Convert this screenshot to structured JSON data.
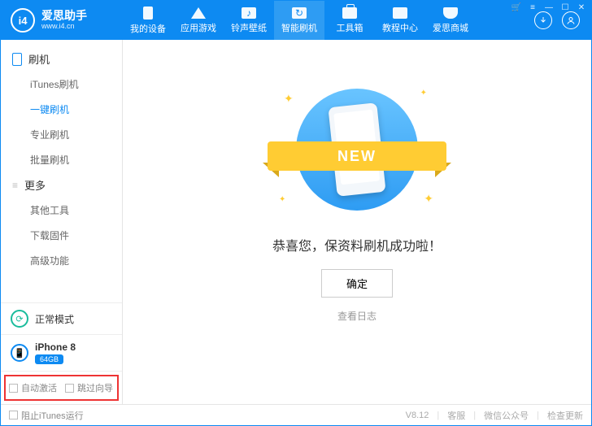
{
  "brand": {
    "name": "爱思助手",
    "sub": "www.i4.cn",
    "badge": "i4"
  },
  "top_tabs": [
    {
      "label": "我的设备"
    },
    {
      "label": "应用游戏"
    },
    {
      "label": "铃声壁纸"
    },
    {
      "label": "智能刷机"
    },
    {
      "label": "工具箱"
    },
    {
      "label": "教程中心"
    },
    {
      "label": "爱思商城"
    }
  ],
  "sidebar": {
    "group1": "刷机",
    "items1": [
      "iTunes刷机",
      "一键刷机",
      "专业刷机",
      "批量刷机"
    ],
    "active1_index": 1,
    "group2": "更多",
    "items2": [
      "其他工具",
      "下载固件",
      "高级功能"
    ]
  },
  "mode_box": {
    "label": "正常模式"
  },
  "device": {
    "name": "iPhone 8",
    "capacity": "64GB"
  },
  "redbox": {
    "auto_activate": "自动激活",
    "skip_guide": "跳过向导"
  },
  "content": {
    "banner": "NEW",
    "success": "恭喜您，保资料刷机成功啦！",
    "ok": "确定",
    "log": "查看日志"
  },
  "footer": {
    "block_itunes": "阻止iTunes运行",
    "version": "V8.12",
    "support": "客服",
    "wechat": "微信公众号",
    "update": "检查更新"
  }
}
